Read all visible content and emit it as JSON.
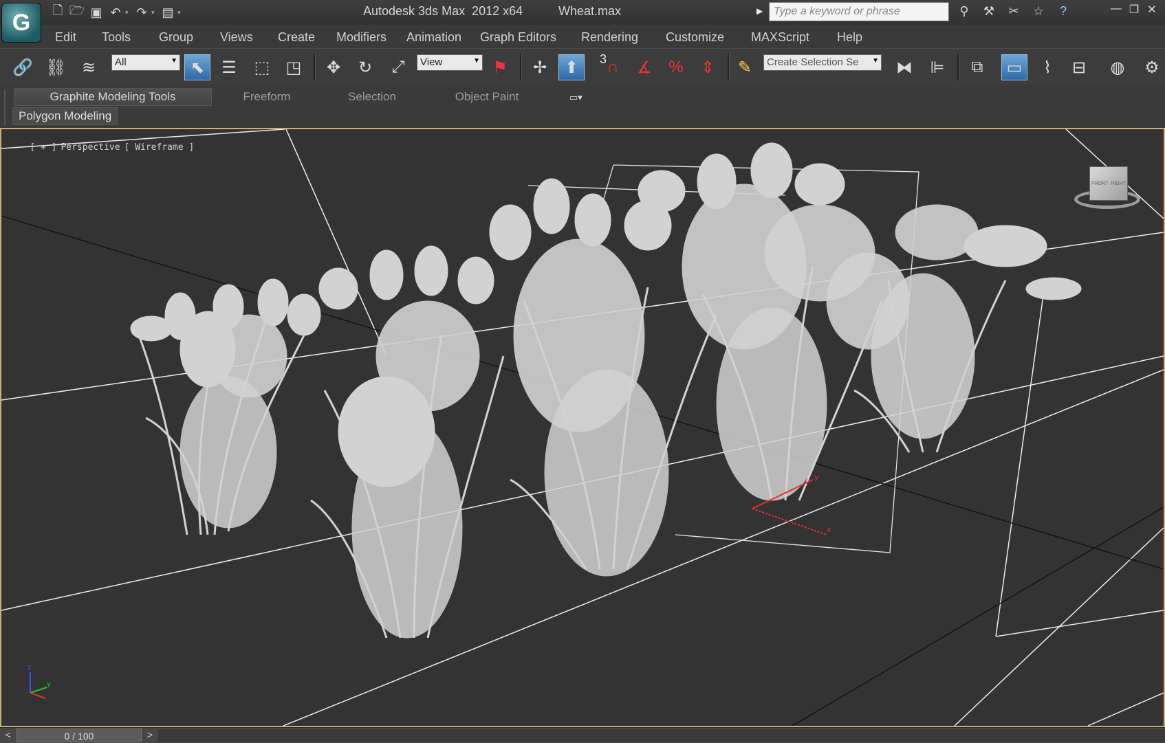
{
  "titlebar": {
    "app_title": "Autodesk 3ds Max  2012 x64",
    "file_name": "Wheat.max",
    "search_placeholder": "Type a keyword or phrase",
    "quick_access": [
      {
        "name": "new-file-icon",
        "glyph": "🗋"
      },
      {
        "name": "open-file-icon",
        "glyph": "🗁"
      },
      {
        "name": "save-icon",
        "glyph": "💾"
      },
      {
        "name": "undo-icon",
        "glyph": "↶"
      },
      {
        "name": "redo-icon",
        "glyph": "↷"
      },
      {
        "name": "project-folder-icon",
        "glyph": "▤"
      }
    ],
    "info_icons": [
      {
        "name": "binoculars-icon",
        "glyph": "⚯"
      },
      {
        "name": "subscription-icon",
        "glyph": "🔧"
      },
      {
        "name": "communication-icon",
        "glyph": "✂"
      },
      {
        "name": "favorites-star-icon",
        "glyph": "☆"
      },
      {
        "name": "help-icon",
        "glyph": "?"
      }
    ],
    "window_controls": {
      "minimize": "—",
      "restore": "❐",
      "close": "✕"
    }
  },
  "menu": [
    "Edit",
    "Tools",
    "Group",
    "Views",
    "Create",
    "Modifiers",
    "Animation",
    "Graph Editors",
    "Rendering",
    "Customize",
    "MAXScript",
    "Help"
  ],
  "toolbar": {
    "selection_filter": "All",
    "reference_coord": "View",
    "snap_value": "3",
    "named_selection_placeholder": "Create Selection Se",
    "buttons": [
      "link-icon",
      "unlink-icon",
      "bind-space-warp-icon",
      "select-object-icon",
      "select-by-name-icon",
      "rectangular-selection-icon",
      "window-crossing-icon",
      "move-icon",
      "rotate-icon",
      "scale-icon",
      "use-pivot-icon",
      "manipulate-icon",
      "keyboard-shortcut-override-icon",
      "snap-toggle-icon",
      "angle-snap-icon",
      "percent-snap-icon",
      "spinner-snap-icon",
      "edit-named-selection-icon",
      "mirror-icon",
      "align-icon",
      "layer-manager-icon",
      "graphite-toggle-icon",
      "curve-editor-icon",
      "schematic-view-icon",
      "material-editor-icon",
      "render-setup-icon"
    ]
  },
  "ribbon": {
    "tabs": [
      "Graphite Modeling Tools",
      "Freeform",
      "Selection",
      "Object Paint"
    ],
    "active_tab": "Graphite Modeling Tools",
    "panel": "Polygon Modeling"
  },
  "viewport": {
    "label_plus": "[ + ]",
    "label_view": "Perspective",
    "label_shading": "[ Wireframe ]",
    "axis_labels": {
      "x": "x",
      "y": "y",
      "z": "z"
    },
    "viewcube_faces": [
      "FRONT",
      "RIGHT"
    ]
  },
  "timeslider": {
    "frame_readout": "0 / 100",
    "prev": "<",
    "next": ">"
  }
}
